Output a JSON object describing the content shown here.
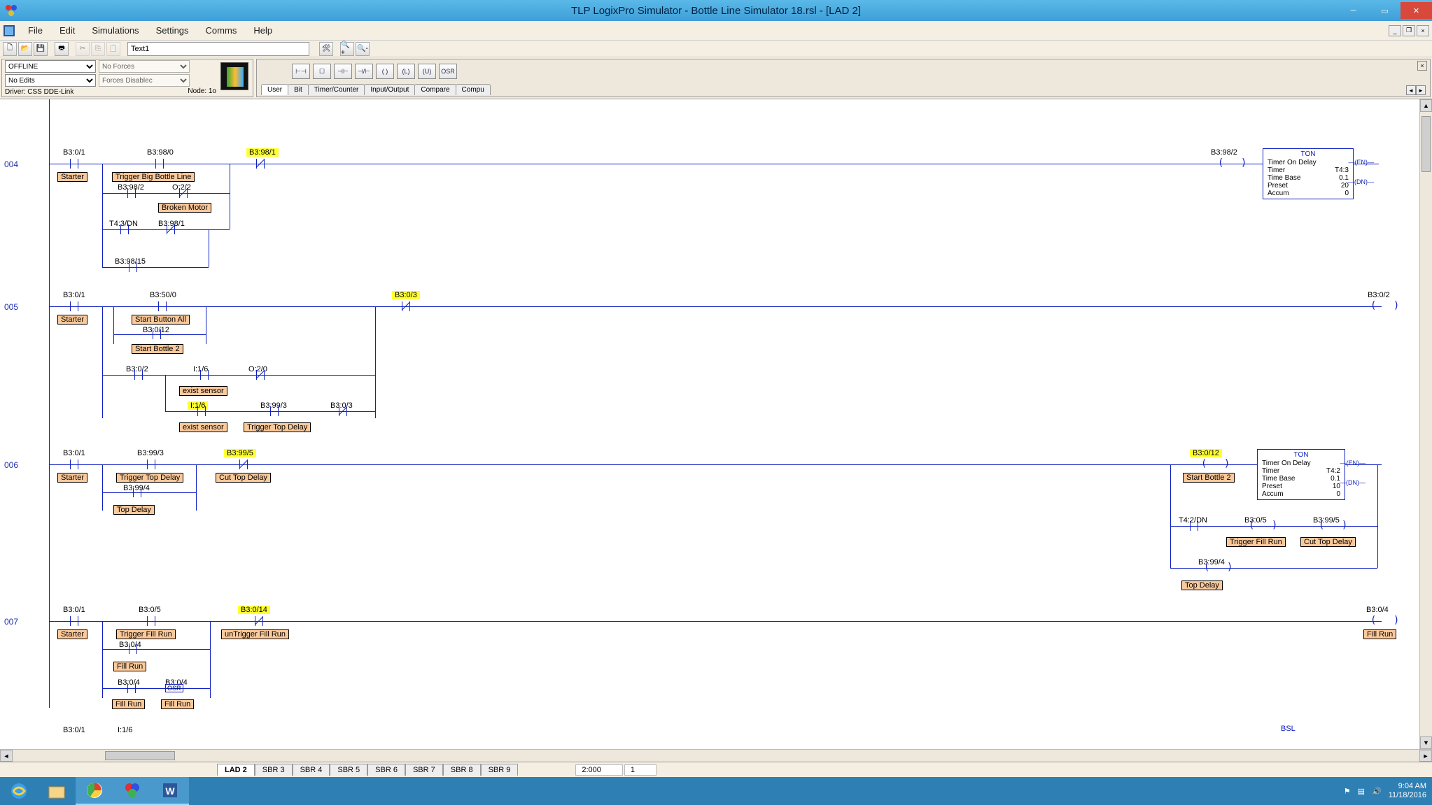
{
  "window": {
    "title": "TLP LogixPro Simulator  -  Bottle Line Simulator 18.rsl - [LAD 2]"
  },
  "menu": [
    "File",
    "Edit",
    "Simulations",
    "Settings",
    "Comms",
    "Help"
  ],
  "toolbar1": {
    "search_value": "Text1"
  },
  "status_panel": {
    "mode": "OFFLINE",
    "forces": "No Forces",
    "edits": "No Edits",
    "forces_enable": "Forces Disablec",
    "driver_label": "Driver:",
    "driver": "CSS DDE-Link",
    "node_label": "Node:",
    "node": "1o"
  },
  "instr": {
    "buttons": [
      "⊢⊣",
      "☐",
      "⊣⊢",
      "⊣/⊢",
      "( )",
      "(L)",
      "(U)",
      "OSR"
    ],
    "tabs": [
      "User",
      "Bit",
      "Timer/Counter",
      "Input/Output",
      "Compare",
      "Compu"
    ]
  },
  "ladder": {
    "rungs": {
      "r004": {
        "no": "004",
        "a1": "B3:0/1",
        "d1": "Starter",
        "a2": "B3:98/0",
        "d2": "Trigger Big Bottle Line",
        "a3": "B3:98/1",
        "a4": "B3:98/2",
        "a5": "O:2/2",
        "d5": "Broken Motor",
        "a6": "T4:3/DN",
        "a7": "B3:98/1",
        "a8": "B3:98/15",
        "out_addr": "B3:98/2",
        "box": {
          "header": "TON",
          "l1": "Timer On Delay",
          "l2l": "Timer",
          "l2r": "T4:3",
          "l3l": "Time Base",
          "l3r": "0.1",
          "l4l": "Preset",
          "l4r": "20",
          "l5l": "Accum",
          "l5r": "0",
          "en": "EN",
          "dn": "DN"
        }
      },
      "r005": {
        "no": "005",
        "a1": "B3:0/1",
        "d1": "Starter",
        "a2": "B3:50/0",
        "d2": "Start Button All",
        "a3": "B3:0/3",
        "a4": "B3:0/12",
        "d4": "Start Bottle 2",
        "a5": "B3:0/2",
        "a6": "I:1/6",
        "d6": "exist sensor",
        "a7": "O:2/0",
        "a8": "I:1/6",
        "d8": "exist sensor",
        "a9": "B3:99/3",
        "d9": "Trigger Top Delay",
        "a10": "B3:0/3",
        "out_addr": "B3:0/2"
      },
      "r006": {
        "no": "006",
        "a1": "B3:0/1",
        "d1": "Starter",
        "a2": "B3:99/3",
        "d2": "Trigger Top Delay",
        "a3": "B3:99/5",
        "d3": "Cut Top Delay",
        "a4": "B3:99/4",
        "d4": "Top Delay",
        "out_addr": "B3:0/12",
        "out_desc": "Start Bottle 2",
        "box": {
          "header": "TON",
          "l1": "Timer On Delay",
          "l2l": "Timer",
          "l2r": "T4:2",
          "l3l": "Time Base",
          "l3r": "0.1",
          "l4l": "Preset",
          "l4r": "10",
          "l5l": "Accum",
          "l5r": "0",
          "en": "EN",
          "dn": "DN"
        },
        "b1": "T4:2/DN",
        "b2": "B3:0/5",
        "b2d": "Trigger Fill Run",
        "b3": "B3:99/5",
        "b3d": "Cut Top Delay",
        "b4": "B3:99/4",
        "b4d": "Top Delay"
      },
      "r007": {
        "no": "007",
        "a1": "B3:0/1",
        "d1": "Starter",
        "a2": "B3:0/5",
        "d2": "Trigger Fill Run",
        "a3": "B3:0/14",
        "d3": "unTrigger Fill Run",
        "a4": "B3:0/4",
        "d4": "Fill Run",
        "a5": "B3:0/4",
        "d5": "Fill Run",
        "a6": "B3:0/4",
        "d6": "Fill Run",
        "osr": "OSR",
        "out_addr": "B3:0/4",
        "out_desc": "Fill Run"
      },
      "r008": {
        "a1": "B3:0/1",
        "a2": "I:1/6",
        "bsl": "BSL"
      }
    }
  },
  "filetabs": [
    "LAD 2",
    "SBR 3",
    "SBR 4",
    "SBR 5",
    "SBR 6",
    "SBR 7",
    "SBR 8",
    "SBR 9"
  ],
  "statusbar": {
    "pos": "2:000",
    "val": "1"
  },
  "clock": {
    "time": "9:04 AM",
    "date": "11/18/2016"
  }
}
